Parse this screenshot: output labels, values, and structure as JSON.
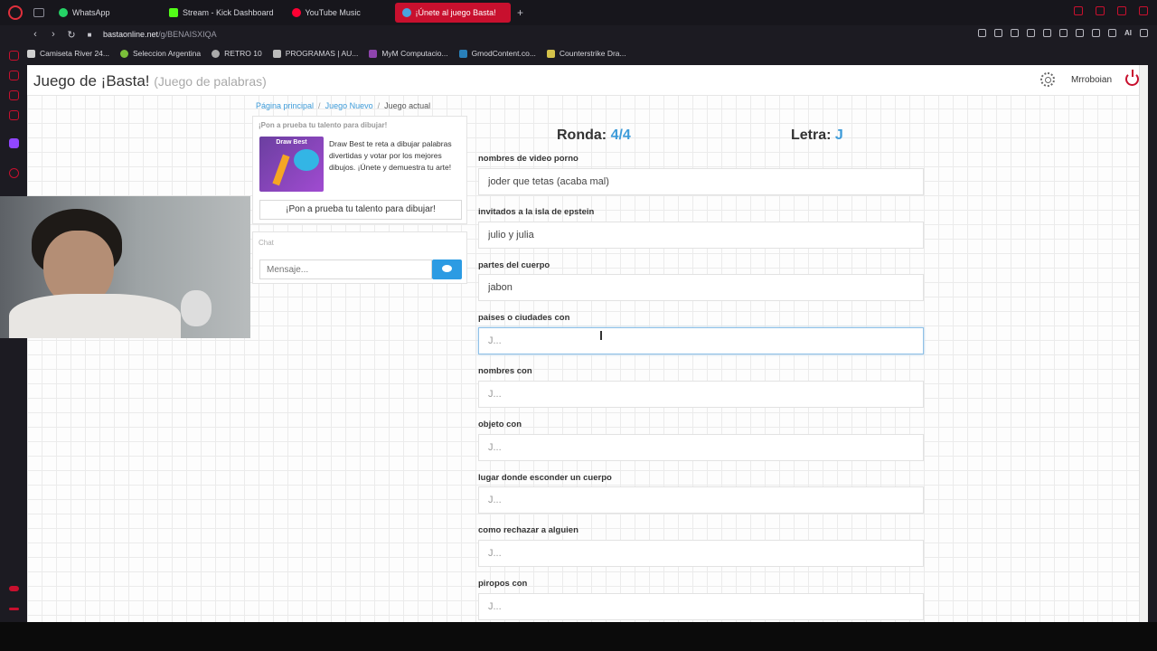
{
  "browser": {
    "tabs": [
      {
        "label": "WhatsApp",
        "color": "#25d366"
      },
      {
        "label": "Stream - Kick Dashboard",
        "color": "#53fc18"
      },
      {
        "label": "YouTube Music",
        "color": "#ff0033"
      },
      {
        "label": "¡Únete al juego Basta!",
        "color": "#4aa3df"
      }
    ],
    "url_host": "bastaonline.net",
    "url_path": "/g/BENAISXIQA",
    "ai_label": "AI",
    "bookmarks": [
      {
        "label": "Camiseta River 24...",
        "color": "#d0d0d0"
      },
      {
        "label": "Seleccion Argentina",
        "color": "#7bbf3a"
      },
      {
        "label": "RETRO 10",
        "color": "#aaaaaa"
      },
      {
        "label": "PROGRAMAS | AU...",
        "color": "#bbbbbb"
      },
      {
        "label": "MyM Computacio...",
        "color": "#8e44ad"
      },
      {
        "label": "GmodContent.co...",
        "color": "#2980b9"
      },
      {
        "label": "Counterstrike Dra...",
        "color": "#d4c24a"
      }
    ]
  },
  "site": {
    "title": "Juego de ¡Basta!",
    "subtitle": "(Juego de palabras)",
    "username": "Mrroboian"
  },
  "breadcrumb": {
    "home": "Página principal",
    "new_game": "Juego Nuevo",
    "current": "Juego actual"
  },
  "promo": {
    "heading": "¡Pon a prueba tu talento para dibujar!",
    "image_label": "Draw Best",
    "text": "Draw Best te reta a dibujar palabras divertidas y votar por los mejores dibujos. ¡Únete y demuestra tu arte!",
    "button": "¡Pon a prueba tu talento para dibujar!"
  },
  "chat": {
    "title": "Chat",
    "placeholder": "Mensaje..."
  },
  "game": {
    "round_label": "Ronda:",
    "round_value": "4/4",
    "letter_label": "Letra:",
    "letter_value": "J",
    "fields": [
      {
        "label": "nombres de video porno",
        "value": "joder que tetas (acaba mal)",
        "placeholder": "J..."
      },
      {
        "label": "invitados a la isla de epstein",
        "value": "julio y julia",
        "placeholder": "J..."
      },
      {
        "label": "partes del cuerpo",
        "value": "jabon",
        "placeholder": "J..."
      },
      {
        "label": "paises o ciudades con",
        "value": "",
        "placeholder": "J..."
      },
      {
        "label": "nombres con",
        "value": "",
        "placeholder": "J..."
      },
      {
        "label": "objeto con",
        "value": "",
        "placeholder": "J..."
      },
      {
        "label": "lugar donde esconder un cuerpo",
        "value": "",
        "placeholder": "J..."
      },
      {
        "label": "como rechazar a alguien",
        "value": "",
        "placeholder": "J..."
      },
      {
        "label": "piropos con",
        "value": "",
        "placeholder": "J..."
      }
    ]
  }
}
